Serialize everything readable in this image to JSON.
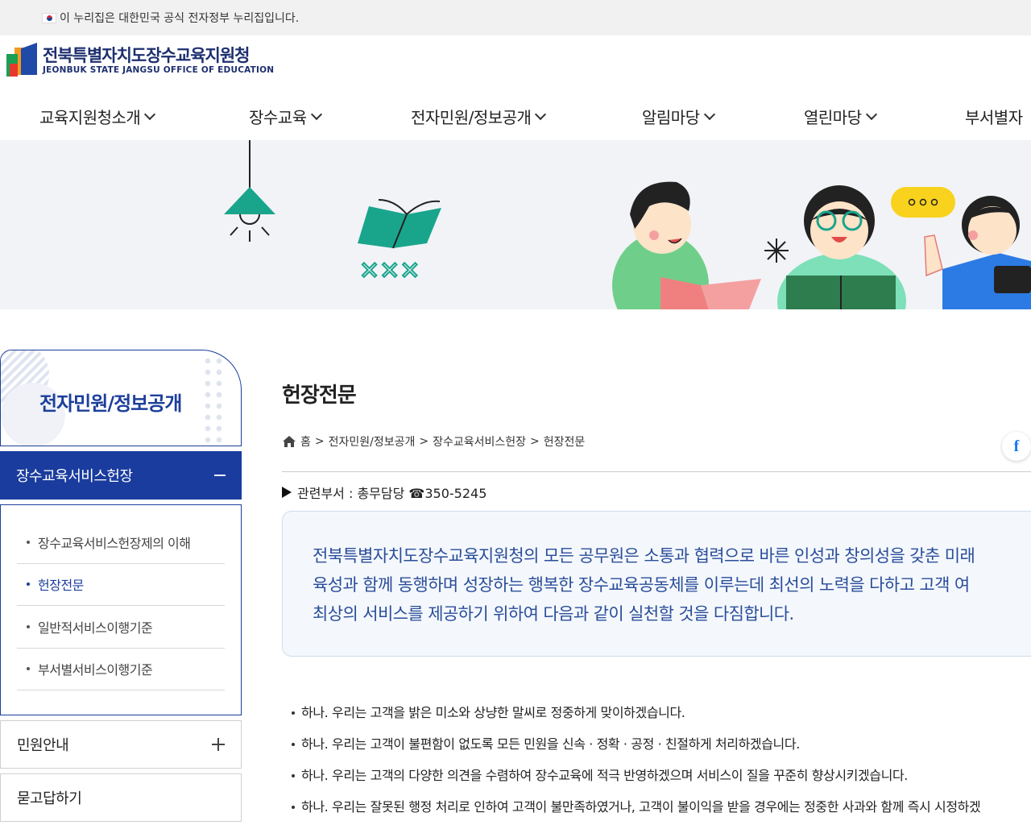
{
  "gov_banner": {
    "text": "이 누리집은 대한민국 공식 전자정부 누리집입니다."
  },
  "logo": {
    "name_ko": "전북특별자치도장수교육지원청",
    "name_en": "JEONBUK STATE JANGSU OFFICE OF EDUCATION"
  },
  "gnb": {
    "items": [
      {
        "label": "교육지원청소개"
      },
      {
        "label": "장수교육"
      },
      {
        "label": "전자민원/정보공개"
      },
      {
        "label": "알림마당"
      },
      {
        "label": "열린마당"
      },
      {
        "label": "부서별자"
      }
    ]
  },
  "lnb": {
    "title": "전자민원/정보공개",
    "open_menu": "장수교육서비스헌장",
    "sub_items": [
      {
        "label": "장수교육서비스헌장제의 이해"
      },
      {
        "label": "헌장전문"
      },
      {
        "label": "일반적서비스이행기준"
      },
      {
        "label": "부서별서비스이행기준"
      }
    ],
    "menus": [
      {
        "label": "민원안내"
      },
      {
        "label": "묻고답하기"
      }
    ]
  },
  "content": {
    "title": "헌장전문",
    "breadcrumb": [
      "홈",
      "전자민원/정보공개",
      "장수교육서비스헌장",
      "헌장전문"
    ],
    "breadcrumb_sep": ">",
    "facebook_label": "f",
    "department": "관련부서 : 총무담당 ☎350-5245",
    "charter_lines": [
      "전북특별자치도장수교육지원청의 모든 공무원은 소통과 협력으로 바른 인성과 창의성을 갖춘 미래",
      "육성과 함께 동행하며 성장하는 행복한 장수교육공동체를 이루는데 최선의 노력을 다하고 고객 여",
      "최상의 서비스를 제공하기 위하여 다음과 같이 실천할 것을 다짐합니다."
    ],
    "pledges": [
      "하나. 우리는 고객을 밝은 미소와 상냥한 말씨로 정중하게 맞이하겠습니다.",
      "하나. 우리는 고객이 불편함이 없도록 모든 민원을 신속 · 정확 · 공정 · 친절하게 처리하겠습니다.",
      "하나. 우리는 고객의 다양한 의견을 수렴하여 장수교육에 적극 반영하겠으며 서비스이 질을 꾸준히 향상시키겠습니다.",
      "하나. 우리는 잘못된 행정 처리로 인하여 고객이 불만족하였거나, 고객이 불이익을 받을 경우에는 정중한 사과와 함께 즉시 시정하겠"
    ]
  },
  "colors": {
    "primary": "#1a3c9e",
    "charter_text": "#2a4d9a",
    "charter_bg": "#f4f8fc",
    "hero_bg": "#f2f3f7",
    "teal": "#19a58c"
  },
  "icons": [
    "korean-flag-icon",
    "home-icon",
    "facebook-icon",
    "chevron-down-icon",
    "minus-icon",
    "plus-icon"
  ]
}
